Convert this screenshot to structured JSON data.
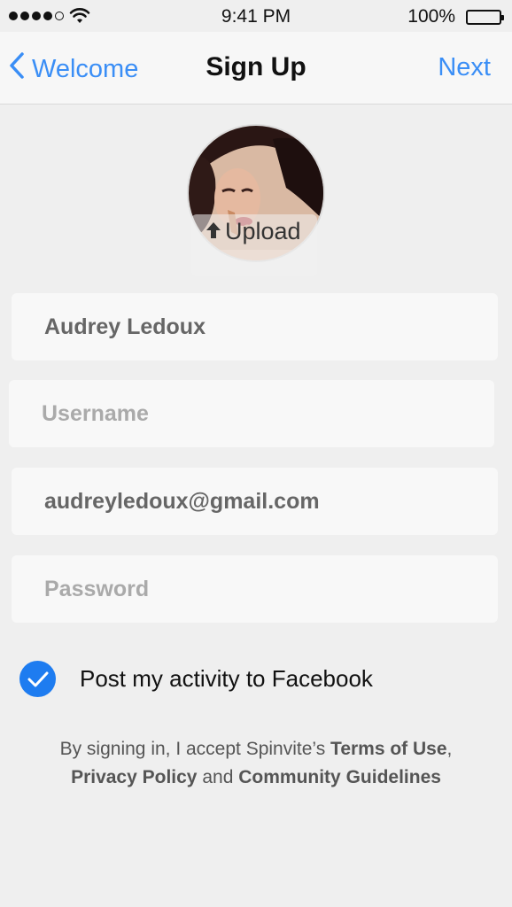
{
  "status_bar": {
    "time": "9:41 PM",
    "battery": "100%"
  },
  "nav": {
    "back_label": "Welcome",
    "title": "Sign Up",
    "next_label": "Next"
  },
  "avatar": {
    "upload_label": "Upload"
  },
  "form": {
    "full_name": {
      "value": "Audrey Ledoux",
      "placeholder": ""
    },
    "username": {
      "value": "",
      "placeholder": "Username"
    },
    "email": {
      "value": "audreyledoux@gmail.com",
      "placeholder": ""
    },
    "password": {
      "value": "",
      "placeholder": "Password"
    }
  },
  "facebook_opt_in": {
    "label": "Post my activity to Facebook",
    "checked": true
  },
  "legal": {
    "prefix": "By signing in, I accept Spinvite’s",
    "terms": "Terms of Use",
    "comma": ",",
    "privacy": "Privacy Policy",
    "and": "and",
    "guidelines": "Community Guidelines"
  },
  "colors": {
    "accent": "#3a8ef6",
    "checkbox": "#1e7cf0",
    "background": "#efefef"
  }
}
